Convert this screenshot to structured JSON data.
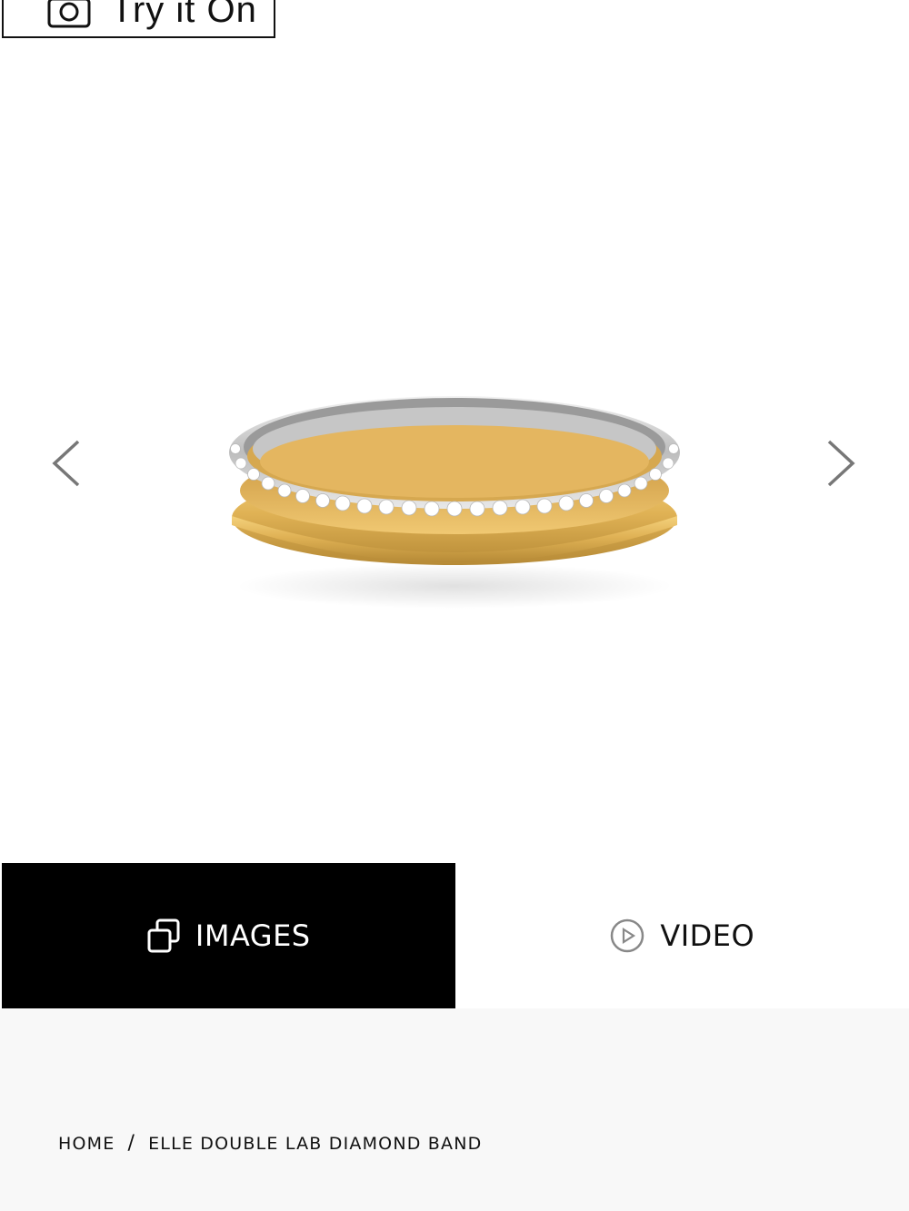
{
  "try_on": {
    "label": "Try it On",
    "icon": "camera-icon"
  },
  "gallery": {
    "image_alt": "Elle Double Lab Diamond Band",
    "prev_icon": "chevron-left-icon",
    "next_icon": "chevron-right-icon"
  },
  "media_tabs": [
    {
      "label": "IMAGES",
      "icon": "images-icon",
      "active": true
    },
    {
      "label": "VIDEO",
      "icon": "play-circle-icon",
      "active": false
    }
  ],
  "breadcrumb": {
    "home": "HOME",
    "separator": "/",
    "current": "ELLE DOUBLE LAB DIAMOND BAND"
  },
  "colors": {
    "active_tab_bg": "#000000",
    "info_bg": "#f8f8f8",
    "gold": "#e0b255",
    "platinum": "#dcdcdc"
  }
}
